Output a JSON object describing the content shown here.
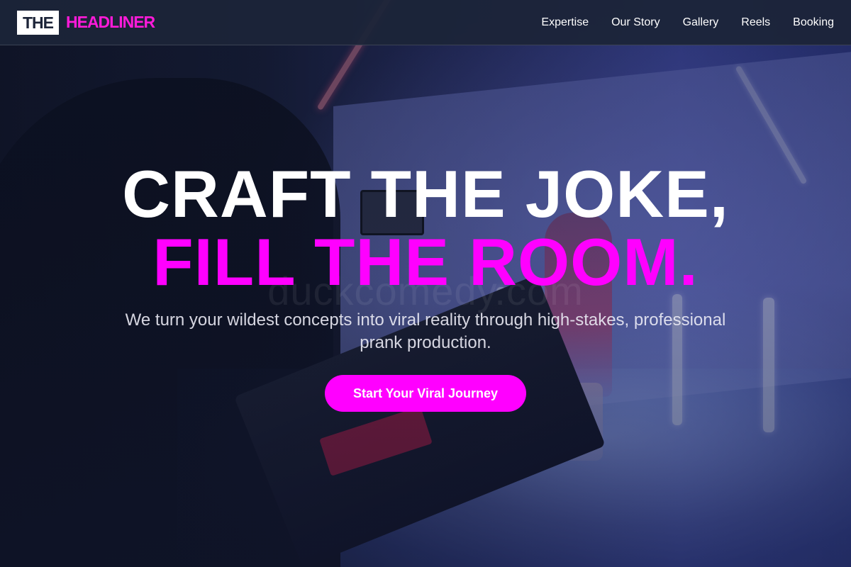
{
  "brand": {
    "logo_box": "THE",
    "logo_text": "HEADLINER",
    "accent_color": "#ff00ff"
  },
  "nav": {
    "items": [
      {
        "label": "Expertise"
      },
      {
        "label": "Our Story"
      },
      {
        "label": "Gallery"
      },
      {
        "label": "Reels"
      },
      {
        "label": "Booking"
      }
    ]
  },
  "hero": {
    "title_line1": "CRAFT THE JOKE,",
    "title_line2": "FILL THE ROOM.",
    "subtitle": "We turn your wildest concepts into viral reality through high-stakes, professional prank production.",
    "cta_label": "Start Your Viral Journey",
    "watermark": "duckcomedy.com"
  }
}
